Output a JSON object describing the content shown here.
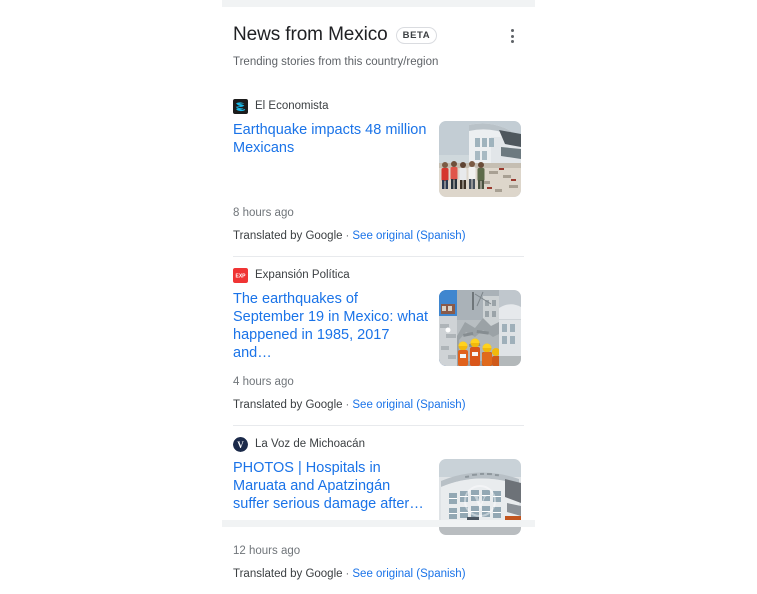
{
  "header": {
    "title": "News from Mexico",
    "badge": "BETA",
    "subtitle": "Trending stories from this country/region",
    "overflow_menu_name": "more options"
  },
  "colors": {
    "link_blue": "#1a73e8",
    "text_primary": "#202124",
    "text_secondary": "#5f6368",
    "text_muted": "#70757a",
    "divider": "#e8eaed",
    "strip": "#f1f3f4"
  },
  "articles": [
    {
      "source": "El Economista",
      "logo_icon": "el-economista-logo-icon",
      "logo_bg": "#1c1c1c",
      "logo_fg": "#19b9e8",
      "headline": "Earthquake impacts 48 million Mexicans",
      "timestamp": "8 hours ago",
      "translated_label": "Translated by Google",
      "separator": "·",
      "original_link": "See original (Spanish)",
      "thumbnail_alt": "damaged building with people walking past rubble"
    },
    {
      "source": "Expansión Política",
      "logo_icon": "expansion-politica-logo-icon",
      "logo_bg": "#f03434",
      "logo_fg": "#ffffff",
      "logo_text": "EXP",
      "headline": "The earthquakes of September 19 in Mexico: what happened in 1985, 2017 and…",
      "timestamp": "4 hours ago",
      "translated_label": "Translated by Google",
      "separator": "·",
      "original_link": "See original (Spanish)",
      "thumbnail_alt": "collage of rescue workers in hard hats at collapsed buildings"
    },
    {
      "source": "La Voz de Michoacán",
      "logo_icon": "la-voz-de-michoacan-logo-icon",
      "logo_bg": "#1b2a4a",
      "logo_fg": "#ffffff",
      "logo_text": "V",
      "headline": "PHOTOS | Hospitals in Maruata and Apatzingán suffer serious damage after…",
      "timestamp": "12 hours ago",
      "translated_label": "Translated by Google",
      "separator": "·",
      "original_link": "See original (Spanish)",
      "thumbnail_alt": "damaged hospital building facade"
    }
  ]
}
